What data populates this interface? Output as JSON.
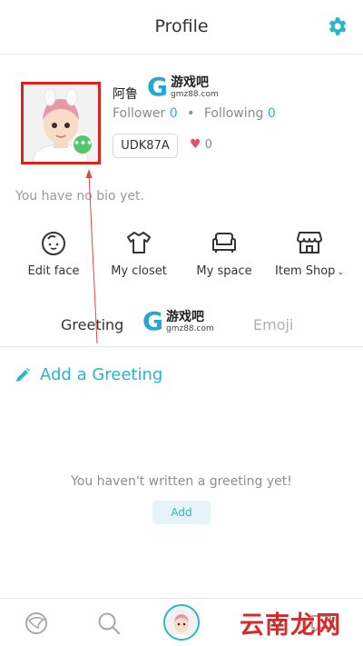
{
  "header": {
    "title": "Profile",
    "settings_icon": "gear-icon"
  },
  "profile": {
    "username": "阿鲁",
    "follower_label": "Follower",
    "follower_count": "0",
    "separator": "•",
    "following_label": "Following",
    "following_count": "0",
    "user_id": "UDK87A",
    "likes_icon": "heart-icon",
    "likes_count": "0",
    "avatar_badge": "•••",
    "bio": "You have no bio yet."
  },
  "watermark": {
    "logo": "G",
    "name": "游戏吧",
    "url": "gmz88.com"
  },
  "actions": [
    {
      "label": "Edit face",
      "icon": "face-icon"
    },
    {
      "label": "My closet",
      "icon": "shirt-icon"
    },
    {
      "label": "My space",
      "icon": "sofa-icon"
    },
    {
      "label": "Item Shop",
      "icon": "shop-icon",
      "chevron": "⌄"
    }
  ],
  "tabs": {
    "greeting": "Greeting",
    "emoji": "Emoji",
    "active": "Greeting"
  },
  "greeting": {
    "add_label": "Add a Greeting",
    "empty_message": "You haven't written a greeting yet!",
    "add_button": "Add"
  },
  "bottom_nav": {
    "items": [
      "home-icon",
      "search-icon",
      "profile-avatar",
      "chat-icon"
    ],
    "corner_watermark": "云南龙网"
  },
  "colors": {
    "accent": "#29b6c9",
    "highlight_box": "#d92323",
    "badge": "#53c76b",
    "heart": "#e2506a"
  }
}
